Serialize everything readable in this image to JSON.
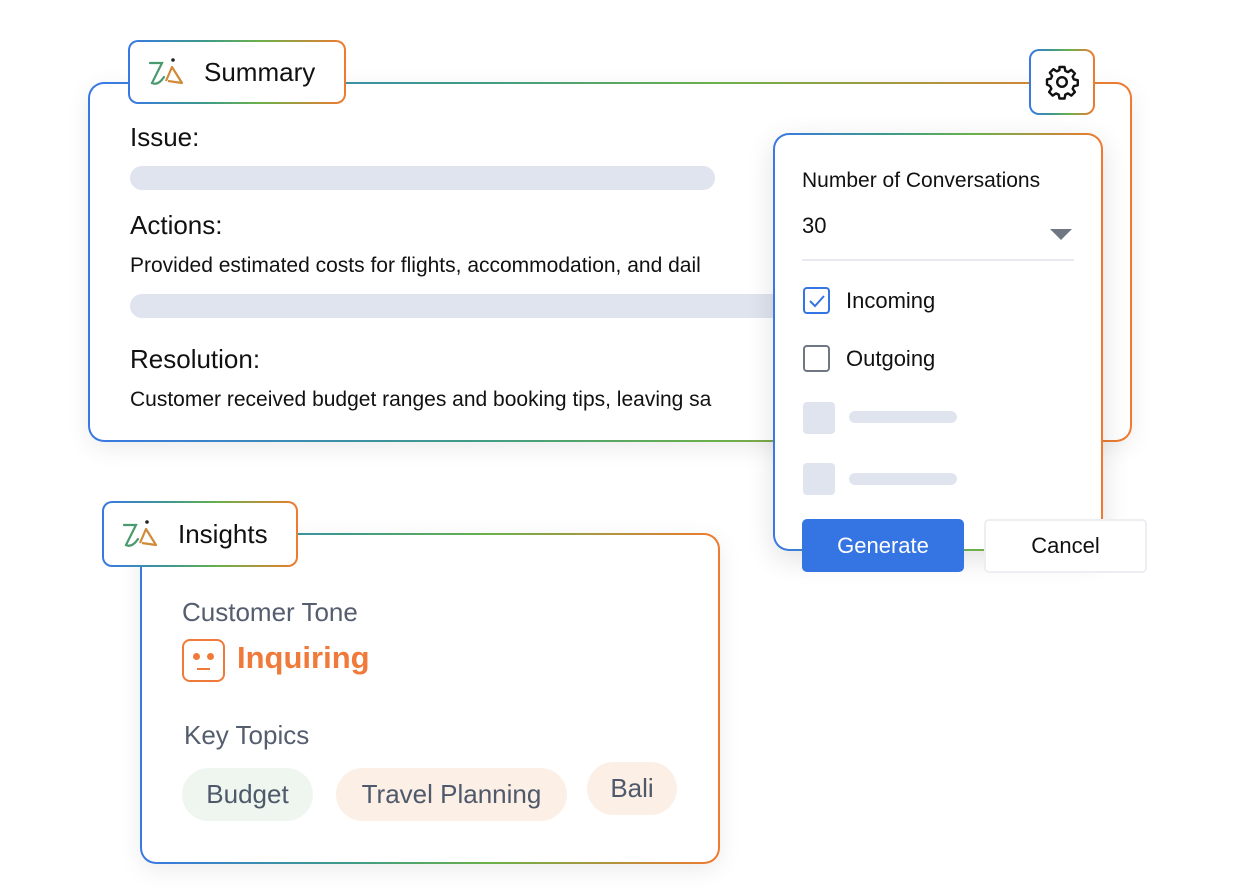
{
  "summary": {
    "tab_label": "Summary",
    "issue_label": "Issue:",
    "actions_label": "Actions:",
    "actions_text": "Provided estimated costs for flights, accommodation, and dail",
    "resolution_label": "Resolution:",
    "resolution_text": "Customer received budget ranges and booking tips, leaving sa"
  },
  "settings_popup": {
    "label": "Number of Conversations",
    "selected_value": "30",
    "options": [
      {
        "label": "Incoming",
        "checked": true
      },
      {
        "label": "Outgoing",
        "checked": false
      }
    ],
    "generate_label": "Generate",
    "cancel_label": "Cancel"
  },
  "insights": {
    "tab_label": "Insights",
    "tone_label": "Customer Tone",
    "tone_value": "Inquiring",
    "topics_label": "Key Topics",
    "topics": [
      "Budget",
      "Travel Planning",
      "Bali"
    ]
  },
  "colors": {
    "accent_blue": "#3574e3",
    "tone_orange": "#f07a3a",
    "chip_green": "#eff6ef",
    "chip_orange": "#fcefe5"
  }
}
